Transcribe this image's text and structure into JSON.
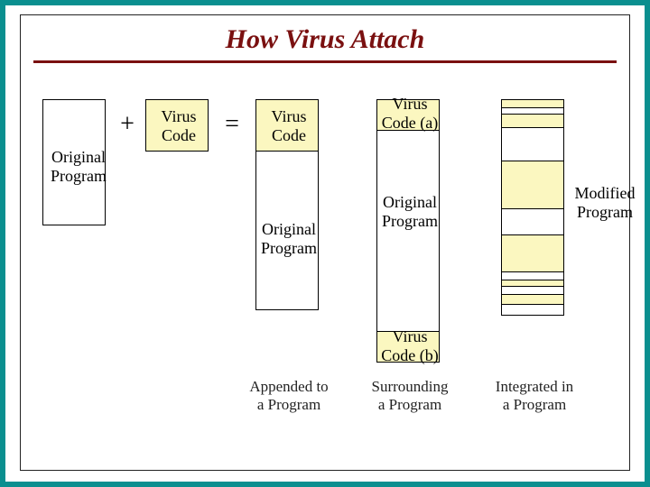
{
  "title": "How Virus Attach",
  "operators": {
    "plus": "+",
    "equals": "="
  },
  "labels": {
    "original_program": "Original\nProgram",
    "virus_code": "Virus\nCode",
    "virus_code_a": "Virus\nCode (a)",
    "virus_code_b": "Virus\nCode (b)",
    "modified_program": "Modified\nProgram"
  },
  "captions": {
    "appended": "Appended to\na Program",
    "surrounding": "Surrounding\na Program",
    "integrated": "Integrated in\na Program"
  },
  "colors": {
    "accent_border": "#0a8f8f",
    "title_color": "#7a1010",
    "virus_fill": "#fbf7c0"
  }
}
